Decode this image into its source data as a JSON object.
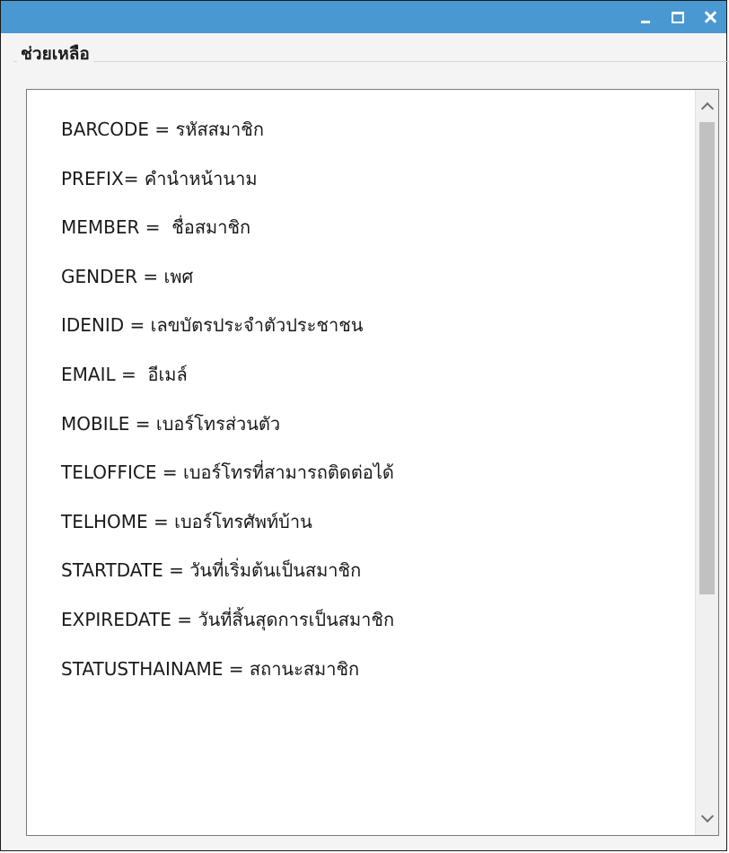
{
  "window": {
    "controls": {
      "minimize_icon": "minimize-icon",
      "maximize_icon": "maximize-icon",
      "close_icon": "close-icon"
    },
    "titlebar_color": "#4a98d2"
  },
  "help_group": {
    "title": "ช่วยเหลือ",
    "items": [
      {
        "label": "BARCODE = รหัสสมาชิก"
      },
      {
        "label": "PREFIX= คำนำหน้านาม"
      },
      {
        "label": "MEMBER =  ชื่อสมาชิก"
      },
      {
        "label": "GENDER = เพศ"
      },
      {
        "label": "IDENID = เลขบัตรประจำตัวประชาชน"
      },
      {
        "label": "EMAIL =  อีเมล์"
      },
      {
        "label": "MOBILE = เบอร์โทรส่วนตัว"
      },
      {
        "label": "TELOFFICE = เบอร์โทรที่สามารถติดต่อได้"
      },
      {
        "label": "TELHOME = เบอร์โทรศัพท์บ้าน"
      },
      {
        "label": "STARTDATE = วันที่เริ่มต้นเป็นสมาชิก"
      },
      {
        "label": "EXPIREDATE = วันที่สิ้นสุดการเป็นสมาชิก"
      },
      {
        "label": "STATUSTHAINAME = สถานะสมาชิก"
      }
    ],
    "scrollbar": {
      "up_icon": "chevron-up-icon",
      "down_icon": "chevron-down-icon",
      "scroll_position": 0.0
    }
  }
}
